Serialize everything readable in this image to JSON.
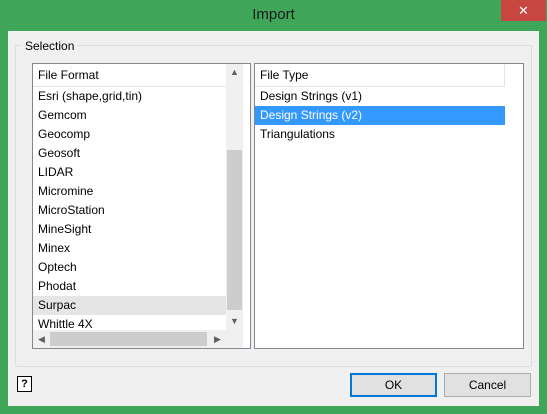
{
  "window": {
    "title": "Import",
    "close_glyph": "✕"
  },
  "selection_group": {
    "label": "Selection"
  },
  "file_format_list": {
    "header": "File Format",
    "items": [
      "Esri (shape,grid,tin)",
      "Gemcom",
      "Geocomp",
      "Geosoft",
      "LIDAR",
      "Micromine",
      "MicroStation",
      "MineSight",
      "Minex",
      "Optech",
      "Phodat",
      "Surpac",
      "Whittle 4X"
    ],
    "highlighted": "Surpac"
  },
  "file_type_list": {
    "header": "File Type",
    "items": [
      "Design Strings (v1)",
      "Design Strings (v2)",
      "Triangulations"
    ],
    "selected": "Design Strings (v2)"
  },
  "scroll_glyphs": {
    "up": "▲",
    "down": "▼",
    "left": "◀",
    "right": "▶"
  },
  "help": {
    "glyph": "?"
  },
  "buttons": {
    "ok": "OK",
    "cancel": "Cancel"
  },
  "colors": {
    "title_bar": "#3fa659",
    "selection": "#3399ff",
    "close": "#c7463f"
  }
}
